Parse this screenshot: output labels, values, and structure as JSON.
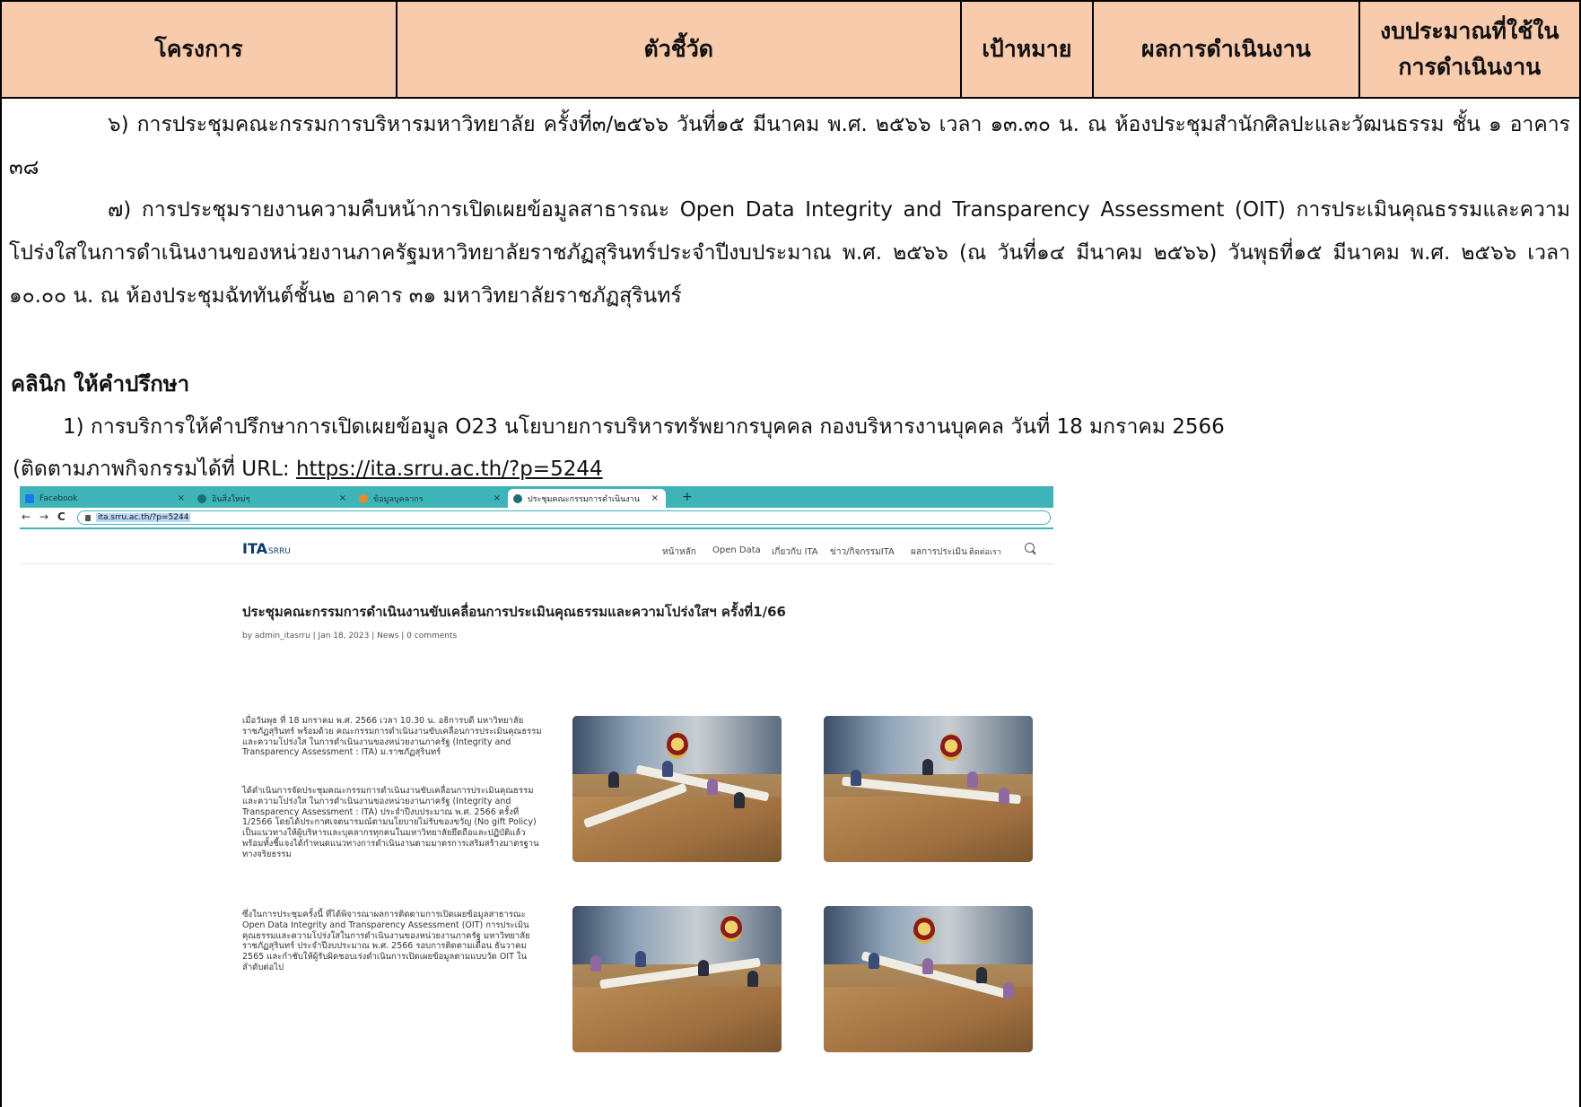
{
  "table_header": {
    "project": "โครงการ",
    "indicator": "ตัวชี้วัด",
    "target": "เป้าหมาย",
    "result": "ผลการดำเนินงาน",
    "budget_line1": "งบประมาณที่ใช้ใน",
    "budget_line2": "การดำเนินงาน"
  },
  "paragraphs": {
    "p6": "๖) การประชุมคณะกรรมการบริหารมหาวิทยาลัย ครั้งที่๓/๒๕๖๖ วันที่๑๕ มีนาคม พ.ศ. ๒๕๖๖ เวลา ๑๓.๓๐ น. ณ ห้องประชุมสำนักศิลปะและวัฒนธรรม ชั้น ๑ อาคาร ๓๘",
    "p7": "๗) การประชุมรายงานความคืบหน้าการเปิดเผยข้อมูลสาธารณะ Open Data Integrity and Transparency Assessment (OIT) การประเมินคุณธรรมและความโปร่งใสในการดำเนินงานของหน่วยงานภาครัฐมหาวิทยาลัยราชภัฏสุรินทร์ประจำปีงบประมาณ พ.ศ. ๒๕๖๖ (ณ วันที่๑๔ มีนาคม ๒๕๖๖) วันพุธที่๑๕ มีนาคม พ.ศ. ๒๕๖๖ เวลา  ๑๐.๐๐ น. ณ ห้องประชุมฉัททันต์ชั้น๒ อาคาร ๓๑ มหาวิทยาลัยราชภัฏสุรินทร์"
  },
  "clinic": {
    "heading": "คลินิก ให้คำปรึกษา",
    "item1": "1) การบริการให้คำปรึกษาการเปิดเผยข้อมูล O23 นโยบายการบริหารทรัพยากรบุคคล กองบริหารงานบุคคล วันที่ 18 มกราคม 2566",
    "url_prefix": "(ติดตามภาพกิจกรรมได้ที่ URL: ",
    "url": "https://ita.srru.ac.th/?p=5244"
  },
  "browser": {
    "tabs": [
      "Facebook",
      "อินสิ่งใหม่ๆ",
      "ข้อมูลบุคลากร",
      "ประชุมคณะกรรมการดำเนินงานขับเคลื่อ"
    ],
    "tab_close": "×",
    "new_tab": "+",
    "nav": {
      "back": "←",
      "forward": "→",
      "reload": "C"
    },
    "address": "ita.srru.ac.th/?p=5244",
    "site": {
      "logo_main": "ITA",
      "logo_sub": "SRRU",
      "menu": [
        "หน้าหลัก",
        "Open Data",
        "เกี่ยวกับ ITA",
        "ข่าว/กิจกรรมITA",
        "ผลการประเมิน",
        "ติดต่อเรา"
      ]
    },
    "post": {
      "title": "ประชุมคณะกรรมการดำเนินงานขับเคลื่อนการประเมินคุณธรรมและความโปร่งใสฯ ครั้งที่1/66",
      "meta": "by admin_itasrru | Jan 18, 2023 | News | 0 comments",
      "para1": "เมื่อวันพุธ ที่ 18 มกราคม พ.ศ. 2566 เวลา 10.30 น. อธิการบดี มหาวิทยาลัยราชภัฏสุรินทร์ พร้อมด้วย คณะกรรมการดำเนินงานขับเคลื่อนการประเมินคุณธรรมและความโปร่งใส ในการดำเนินงานของหน่วยงานภาครัฐ (Integrity and Transparency Assessment : ITA) ม.ราชภัฏสุรินทร์",
      "para2": "ได้ดำเนินการจัดประชุมคณะกรรมการดำเนินงานขับเคลื่อนการประเมินคุณธรรมและความโปร่งใส ในการดำเนินงานของหน่วยงานภาครัฐ (Integrity and Transparency Assessment : ITA) ประจำปีงบประมาณ พ.ศ. 2566 ครั้งที่ 1/2566 โดยได้ประกาศเจตนารมณ์ตามนโยบายไม่รับของขวัญ (No gift Policy) เป็นแนวทางให้ผู้บริหารและบุคลากรทุกคนในมหาวิทยาลัยยึดถือและปฏิบัติแล้ว พร้อมทั้งชี้แจงได้กำหนดแนวทางการดำเนินงานตามมาตรการเสริมสร้างมาตรฐานทางจริยธรรม",
      "para3": "ซึ่งในการประชุมครั้งนี้ ที่ได้พิจารณาผลการติดตามการเปิดเผยข้อมูลสาธารณะ Open Data Integrity and Transparency Assessment (OIT) การประเมินคุณธรรมและความโปร่งใสในการดำเนินงานของหน่วยงานภาครัฐ มหาวิทยาลัยราชภัฏสุรินทร์ ประจำปีงบประมาณ พ.ศ. 2566 รอบการติดตามเดือน ธันวาคม 2565 และกำชับให้ผู้รับผิดชอบเร่งดำเนินการเปิดเผยข้อมูลตามแบบวัด OIT ในลำดับต่อไป"
    }
  }
}
